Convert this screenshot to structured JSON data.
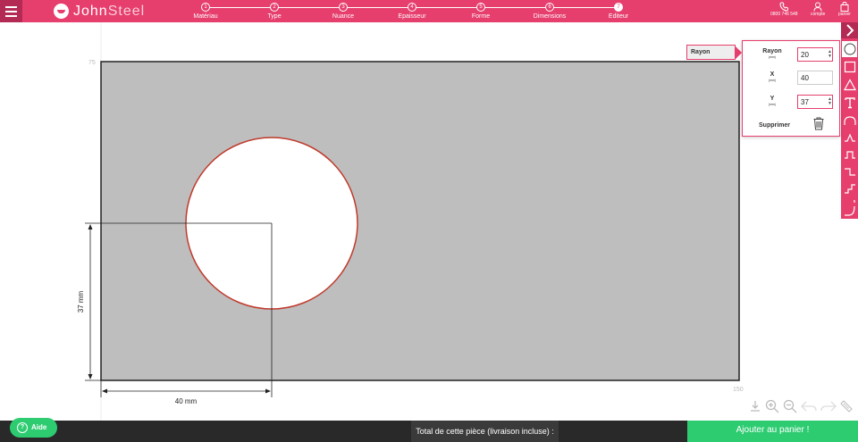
{
  "header": {
    "brand": {
      "first": "John",
      "second": "Steel"
    },
    "steps": [
      {
        "num": "1",
        "label": "Matériau"
      },
      {
        "num": "2",
        "label": "Type"
      },
      {
        "num": "3",
        "label": "Nuance"
      },
      {
        "num": "4",
        "label": "Epaisseur"
      },
      {
        "num": "5",
        "label": "Forme"
      },
      {
        "num": "6",
        "label": "Dimensions"
      },
      {
        "num": "7",
        "label": "Editeur"
      }
    ],
    "phone": "0800 746 548",
    "account_label": "compte",
    "cart_label": "panier"
  },
  "canvas": {
    "axis_top_value": "75",
    "axis_right_value": "150",
    "dim_vertical": "37 mm",
    "dim_horizontal": "40 mm"
  },
  "editor": {
    "tab_label": "Rayon",
    "fields": {
      "rayon": {
        "label": "Rayon",
        "unit": "(mm)",
        "value": "20"
      },
      "x": {
        "label": "X",
        "unit": "(mm)",
        "value": "40"
      },
      "y": {
        "label": "Y",
        "unit": "(mm)",
        "value": "37"
      }
    },
    "delete_label": "Supprimer"
  },
  "tools": [
    "circle-icon",
    "square-icon",
    "triangle-icon",
    "text-icon",
    "arc-icon",
    "peak-icon",
    "notch-icon",
    "step-icon",
    "step-down-icon",
    "corner-icon",
    "curve-icon"
  ],
  "footer": {
    "help_label": "Aide",
    "total_label": "Total de cette pièce (livraison incluse) :",
    "add_to_cart_label": "Ajouter au panier !"
  },
  "colors": {
    "brand": "#e63e6d",
    "accent_green": "#2ecc71",
    "plate": "#bebebe",
    "hole_stroke": "#c0392b"
  }
}
